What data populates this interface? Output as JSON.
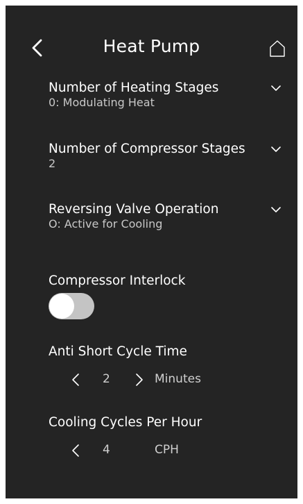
{
  "header": {
    "title": "Heat Pump",
    "back_icon": "chevron-left-icon",
    "home_icon": "home-icon"
  },
  "settings": {
    "heating_stages": {
      "label": "Number of Heating Stages",
      "value": "0: Modulating Heat"
    },
    "compressor_stages": {
      "label": "Number of Compressor Stages",
      "value": "2"
    },
    "reversing_valve": {
      "label": "Reversing Valve Operation",
      "value": "O: Active for Cooling"
    },
    "compressor_interlock": {
      "label": "Compressor Interlock",
      "enabled": false
    },
    "anti_short_cycle": {
      "label": "Anti Short Cycle Time",
      "value": "2",
      "unit": "Minutes"
    },
    "cooling_cycles": {
      "label": "Cooling Cycles Per Hour",
      "value": "4",
      "unit": "CPH"
    }
  },
  "colors": {
    "background": "#242424",
    "text": "#ffffff",
    "toggle_track_off": "#c4c4c4"
  }
}
